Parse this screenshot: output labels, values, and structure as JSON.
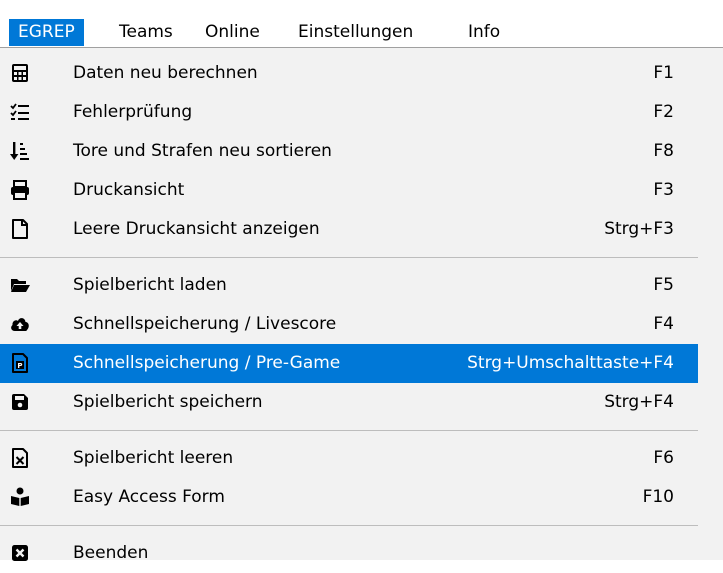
{
  "menubar": {
    "items": [
      {
        "label": "EGREP",
        "active": true
      },
      {
        "label": "Teams"
      },
      {
        "label": "Online"
      },
      {
        "label": "Einstellungen"
      },
      {
        "label": "Info"
      }
    ]
  },
  "menu": {
    "selected_color": "#0078d7",
    "items": [
      {
        "label": "Daten neu berechnen",
        "shortcut": "F1",
        "icon": "calculator-icon"
      },
      {
        "label": "Fehlerprüfung",
        "shortcut": "F2",
        "icon": "checklist-icon"
      },
      {
        "label": "Tore und Strafen neu sortieren",
        "shortcut": "F8",
        "icon": "sort-icon"
      },
      {
        "label": "Druckansicht",
        "shortcut": "F3",
        "icon": "printer-icon"
      },
      {
        "label": "Leere Druckansicht anzeigen",
        "shortcut": "Strg+F3",
        "icon": "blank-page-icon"
      },
      {
        "label": "Spielbericht laden",
        "shortcut": "F5",
        "icon": "folder-open-icon"
      },
      {
        "label": "Schnellspeicherung / Livescore",
        "shortcut": "F4",
        "icon": "cloud-upload-icon"
      },
      {
        "label": "Schnellspeicherung / Pre-Game",
        "shortcut": "Strg+Umschalttaste+F4",
        "icon": "file-p-icon",
        "selected": true
      },
      {
        "label": "Spielbericht speichern",
        "shortcut": "Strg+F4",
        "icon": "save-icon"
      },
      {
        "label": "Spielbericht leeren",
        "shortcut": "F6",
        "icon": "file-x-icon"
      },
      {
        "label": "Easy Access Form",
        "shortcut": "F10",
        "icon": "reader-icon"
      },
      {
        "label": "Beenden",
        "shortcut": "",
        "icon": "close-box-icon"
      }
    ]
  }
}
